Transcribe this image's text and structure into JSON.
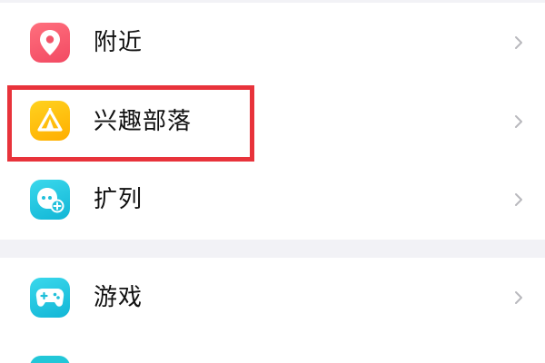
{
  "menu": {
    "items": [
      {
        "label": "附近",
        "icon": "location-pin-icon",
        "color": "#f2556a"
      },
      {
        "label": "兴趣部落",
        "icon": "tent-icon",
        "color": "#ffbe12"
      },
      {
        "label": "扩列",
        "icon": "add-friend-face-icon",
        "color": "#26c9e0"
      },
      {
        "label": "游戏",
        "icon": "gamepad-icon",
        "color": "#26c9e0"
      }
    ]
  },
  "highlight": {
    "color": "#e8333b",
    "target": "兴趣部落"
  },
  "colors": {
    "separator": "#f2f2f6",
    "chevron": "#b8b8bd",
    "text": "#111111"
  }
}
